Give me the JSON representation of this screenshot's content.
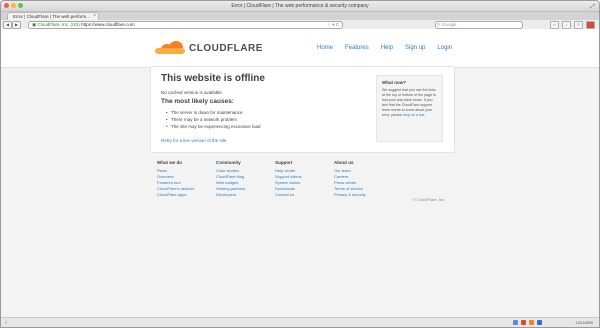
{
  "window": {
    "title": "Error | CloudFlare | The web performance & security company"
  },
  "tab": {
    "label": "Error | CloudFlare | The web perform..."
  },
  "toolbar": {
    "back": "◀",
    "forward": "▶",
    "url_owner": "CloudFlare, Inc. (US)",
    "url_path": "https://www.cloudflare.com",
    "search_placeholder": "Google",
    "reload_glyph": "☆ ▾ C"
  },
  "header": {
    "logo_text": "CLOUDFLARE",
    "nav": [
      "Home",
      "Features",
      "Help",
      "Sign up",
      "Login"
    ]
  },
  "main": {
    "title": "This website is offline",
    "no_cache": "No cached version is available.",
    "causes_title": "The most likely causes:",
    "causes": [
      "The server is down for maintenance",
      "There may be a network problem",
      "The site may be experiencing excessive load"
    ],
    "retry_link": "Retry for a live version of the site"
  },
  "whatnow": {
    "title": "What now?",
    "text": "We suggest that you use the links at the top or bottom of the page to find your way back home. If you feel that the CloudFlare support team needs to know about your error, please",
    "link": "drop us a line."
  },
  "footer": {
    "columns": [
      {
        "title": "What we do",
        "links": [
          "Plans",
          "Overview",
          "Features tour",
          "CloudFlare's network",
          "CloudFlare apps"
        ]
      },
      {
        "title": "Community",
        "links": [
          "Case studies",
          "CloudFlare blog",
          "Web badges",
          "Hosting partners",
          "Developers"
        ]
      },
      {
        "title": "Support",
        "links": [
          "Help center",
          "Support videos",
          "System status",
          "Downloads",
          "Contact us"
        ]
      },
      {
        "title": "About us",
        "links": [
          "Our team",
          "Careers",
          "Press center",
          "Terms of service",
          "Privacy & security"
        ]
      }
    ],
    "copyright": "© CloudFlare, Inc."
  },
  "statusbar": {
    "text": "1331x899",
    "left": "≡"
  },
  "colors": {
    "accent": "#f6821f",
    "link": "#2f7bbf"
  }
}
